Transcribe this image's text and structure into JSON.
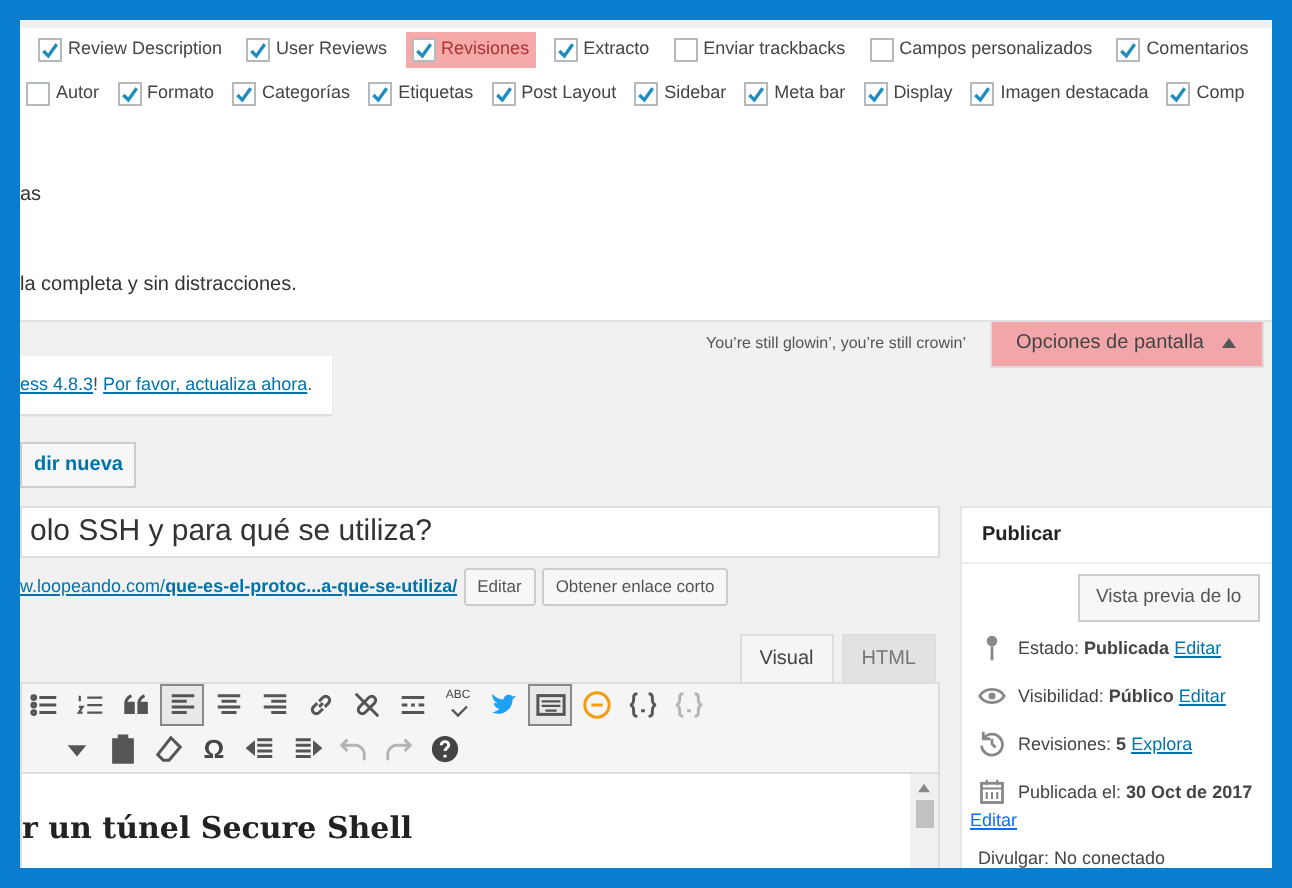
{
  "screen_options": {
    "checkbox_rows": [
      [
        {
          "label": "Review Description",
          "checked": true,
          "highlighted": false
        },
        {
          "label": "User Reviews",
          "checked": true,
          "highlighted": false
        },
        {
          "label": "Revisiones",
          "checked": true,
          "highlighted": true
        },
        {
          "label": "Extracto",
          "checked": true,
          "highlighted": false
        },
        {
          "label": "Enviar trackbacks",
          "checked": false,
          "highlighted": false
        },
        {
          "label": "Campos personalizados",
          "checked": false,
          "highlighted": false
        },
        {
          "label": "Comentarios",
          "checked": true,
          "highlighted": false
        }
      ],
      [
        {
          "label": "Autor",
          "checked": false,
          "highlighted": false
        },
        {
          "label": "Formato",
          "checked": true,
          "highlighted": false
        },
        {
          "label": "Categorías",
          "checked": true,
          "highlighted": false
        },
        {
          "label": "Etiquetas",
          "checked": true,
          "highlighted": false
        },
        {
          "label": "Post Layout",
          "checked": true,
          "highlighted": false
        },
        {
          "label": "Sidebar",
          "checked": true,
          "highlighted": false
        },
        {
          "label": "Meta bar",
          "checked": true,
          "highlighted": false
        },
        {
          "label": "Display",
          "checked": true,
          "highlighted": false
        },
        {
          "label": "Imagen destacada",
          "checked": true,
          "highlighted": false
        },
        {
          "label": "Comp",
          "checked": true,
          "highlighted": false
        }
      ]
    ],
    "texts": [
      "as",
      "la completa y sin distracciones."
    ]
  },
  "tagline": "You’re still glowin’, you’re still crowin’",
  "screen_options_button": {
    "label": "Opciones de pantalla",
    "highlighted": true
  },
  "notice": [
    {
      "kind": "link",
      "text": "ess 4.8.3"
    },
    {
      "kind": "text",
      "text": "! "
    },
    {
      "kind": "link",
      "text": "Por favor, actualiza ahora"
    },
    {
      "kind": "text",
      "text": "."
    }
  ],
  "add_new_button": "dir nueva",
  "post_title": "olo SSH y para qué se utiliza?",
  "permalink": {
    "link": "w.loopeando.com/**que-es-el-protoc...a-que-se-utiliza/**",
    "buttons": [
      "Editar",
      "Obtener enlace corto"
    ]
  },
  "editor_tabs": [
    {
      "label": "Visual",
      "selected": true
    },
    {
      "label": "HTML",
      "selected": false
    }
  ],
  "toolbar_rows": [
    [
      {
        "kind": "bullets",
        "pressed": false,
        "disabled": false
      },
      {
        "kind": "numbers",
        "pressed": false,
        "disabled": false
      },
      {
        "kind": "quote",
        "pressed": false,
        "disabled": false
      },
      {
        "kind": "alignleft",
        "pressed": true,
        "disabled": false
      },
      {
        "kind": "aligncenter",
        "pressed": false,
        "disabled": false
      },
      {
        "kind": "alignright",
        "pressed": false,
        "disabled": false
      },
      {
        "kind": "link",
        "pressed": false,
        "disabled": false
      },
      {
        "kind": "unlink",
        "pressed": false,
        "disabled": false
      },
      {
        "kind": "more",
        "pressed": false,
        "disabled": false
      },
      {
        "kind": "spellcheck",
        "glyph": "ABC",
        "pressed": false,
        "disabled": false
      },
      {
        "kind": "bird",
        "pressed": false,
        "disabled": false
      },
      {
        "kind": "keyboard",
        "pressed": true,
        "disabled": false
      },
      {
        "kind": "ring",
        "pressed": false,
        "disabled": false
      },
      {
        "kind": "braces",
        "pressed": false,
        "disabled": false
      },
      {
        "kind": "braces",
        "pressed": false,
        "disabled": true
      }
    ],
    [
      {
        "kind": "caret",
        "pressed": false,
        "disabled": false
      },
      {
        "kind": "paste",
        "pressed": false,
        "disabled": false
      },
      {
        "kind": "eraser",
        "pressed": false,
        "disabled": false
      },
      {
        "kind": "char",
        "glyph": "Ω",
        "pressed": false,
        "disabled": false
      },
      {
        "kind": "outdent",
        "pressed": false,
        "disabled": false
      },
      {
        "kind": "indent",
        "pressed": false,
        "disabled": false
      },
      {
        "kind": "undo",
        "pressed": false,
        "disabled": true
      },
      {
        "kind": "redo",
        "pressed": false,
        "disabled": true
      },
      {
        "kind": "help",
        "pressed": false,
        "disabled": false
      }
    ]
  ],
  "content_heading": "r un túnel Secure Shell",
  "publish_box": {
    "title": "Publicar",
    "preview_button": "Vista previa de lo",
    "items": [
      {
        "kind": "status",
        "text": "Estado: **Publicada**",
        "link": "Editar"
      },
      {
        "kind": "visibility",
        "text": "Visibilidad: **Público**",
        "link": "Editar"
      },
      {
        "kind": "revisions",
        "text": "Revisiones: **5**",
        "link": "Explora"
      },
      {
        "kind": "date",
        "text": "Publicada el: **30 Oct de 2017**",
        "link": "Editar"
      },
      {
        "kind": "plain",
        "text": "Divulgar: No conectado"
      }
    ]
  }
}
